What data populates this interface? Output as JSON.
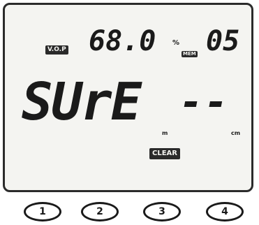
{
  "display": {
    "vop_label": "V.O.P",
    "percent_value": "68.0",
    "percent_unit": "%",
    "mem_label": "MEM",
    "mem_value": "05",
    "main_text": "SUrE",
    "main_dashes": "--",
    "unit_m": "m",
    "unit_cm": "cm",
    "clear_label": "CLEAR"
  },
  "buttons": [
    {
      "label": "1"
    },
    {
      "label": "2"
    },
    {
      "label": "3"
    },
    {
      "label": "4"
    }
  ],
  "colors": {
    "lcd_background": "#f4f4f1",
    "segment": "#1a1a1a",
    "frame": "#2b2b2b"
  }
}
